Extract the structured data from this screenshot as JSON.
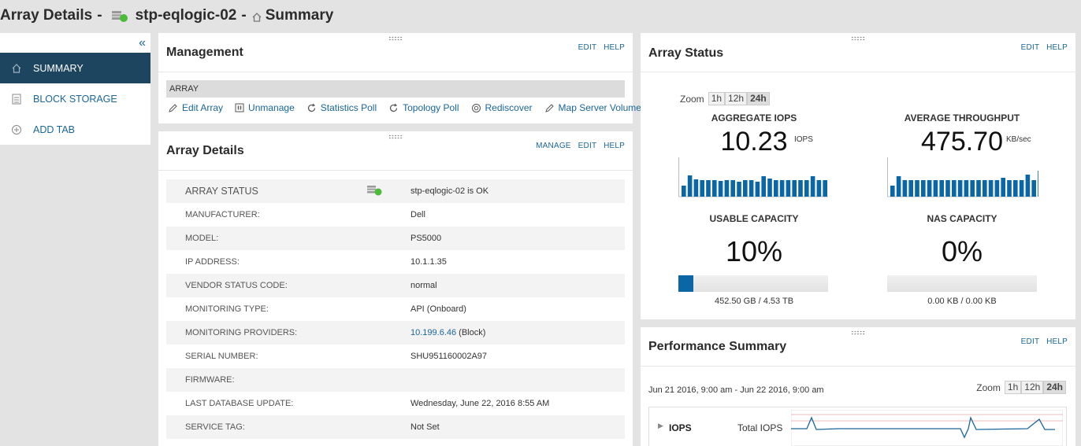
{
  "header": {
    "title": "Array Details",
    "separator": "-",
    "array_name": "stp-eqlogic-02",
    "separator2": "-",
    "view_name": "Summary"
  },
  "sidebar": {
    "items": [
      {
        "label": "SUMMARY",
        "icon": "home-icon",
        "active": true
      },
      {
        "label": "BLOCK STORAGE",
        "icon": "storage-icon",
        "active": false
      },
      {
        "label": "ADD TAB",
        "icon": "plus-circle-icon",
        "active": false
      }
    ]
  },
  "management": {
    "title": "Management",
    "links": [
      "EDIT",
      "HELP"
    ],
    "bar_label": "ARRAY",
    "actions": [
      {
        "label": "Edit Array",
        "icon": "pencil-icon"
      },
      {
        "label": "Unmanage",
        "icon": "pause-icon"
      },
      {
        "label": "Statistics Poll",
        "icon": "refresh-icon"
      },
      {
        "label": "Topology Poll",
        "icon": "refresh-icon"
      },
      {
        "label": "Rediscover",
        "icon": "rediscover-icon"
      },
      {
        "label": "Map Server Volumes",
        "icon": "pencil-icon"
      }
    ]
  },
  "array_details": {
    "title": "Array Details",
    "links": [
      "MANAGE",
      "EDIT",
      "HELP"
    ],
    "rows": [
      {
        "key": "ARRAY STATUS",
        "value": "stp-eqlogic-02 is OK"
      },
      {
        "key": "MANUFACTURER:",
        "value": "Dell"
      },
      {
        "key": "MODEL:",
        "value": "PS5000"
      },
      {
        "key": "IP ADDRESS:",
        "value": "10.1.1.35"
      },
      {
        "key": "VENDOR STATUS CODE:",
        "value": "normal"
      },
      {
        "key": "MONITORING TYPE:",
        "value": "API (Onboard)"
      },
      {
        "key": "MONITORING PROVIDERS:",
        "value_link": "10.199.6.46",
        "value": " (Block)"
      },
      {
        "key": "SERIAL NUMBER:",
        "value": "SHU951160002A97"
      },
      {
        "key": "FIRMWARE:",
        "value": ""
      },
      {
        "key": "LAST DATABASE UPDATE:",
        "value": "Wednesday, June 22, 2016 8:55 AM"
      },
      {
        "key": "SERVICE TAG:",
        "value": "Not Set"
      }
    ]
  },
  "array_status": {
    "title": "Array Status",
    "links": [
      "EDIT",
      "HELP"
    ],
    "zoom_label": "Zoom",
    "zoom_options": [
      "1h",
      "12h",
      "24h"
    ],
    "zoom_selected": "24h",
    "iops": {
      "label": "AGGREGATE IOPS",
      "value": "10.23",
      "unit": "IOPS"
    },
    "throughput": {
      "label": "AVERAGE THROUGHPUT",
      "value": "475.70",
      "unit": "KB/sec"
    },
    "usable_capacity": {
      "label": "USABLE CAPACITY",
      "value": "10%",
      "fraction": 0.1,
      "detail": "452.50 GB / 4.53 TB"
    },
    "nas_capacity": {
      "label": "NAS CAPACITY",
      "value": "0%",
      "fraction": 0.0,
      "detail": "0.00 KB / 0.00 KB"
    },
    "colors": {
      "accent": "#0b66a6",
      "status_ok": "#4cbb3a"
    }
  },
  "performance": {
    "title": "Performance Summary",
    "links": [
      "EDIT",
      "HELP"
    ],
    "range": "Jun 21 2016, 9:00 am - Jun 22 2016, 9:00 am",
    "zoom_label": "Zoom",
    "zoom_options": [
      "1h",
      "12h",
      "24h"
    ],
    "zoom_selected": "24h",
    "row_label": "IOPS",
    "row_value": "Total IOPS"
  }
}
